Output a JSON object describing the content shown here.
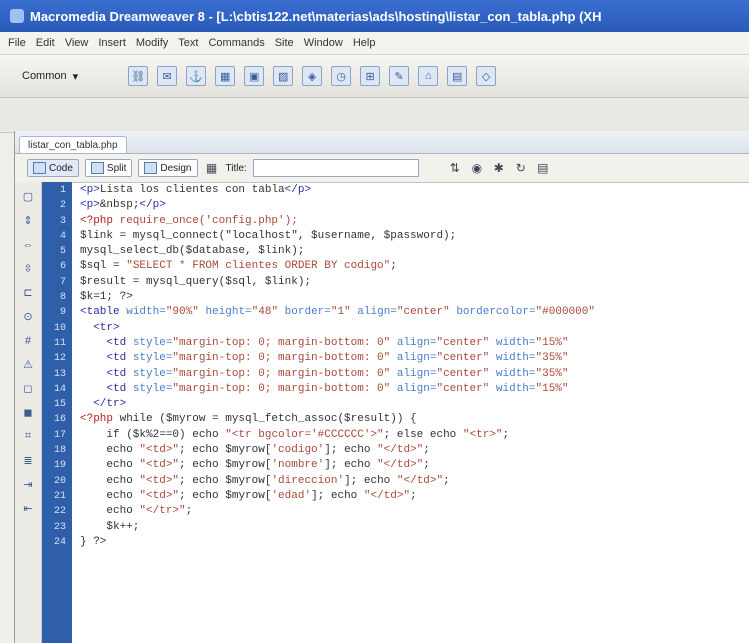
{
  "window": {
    "title": "Macromedia Dreamweaver 8 - [L:\\cbtis122.net\\materias\\ads\\hosting\\listar_con_tabla.php (XH"
  },
  "menu": [
    "File",
    "Edit",
    "View",
    "Insert",
    "Modify",
    "Text",
    "Commands",
    "Site",
    "Window",
    "Help"
  ],
  "insert_bar": {
    "category": "Common",
    "icons": [
      "hyperlink-icon",
      "email-icon",
      "anchor-icon",
      "table-icon",
      "div-icon",
      "images-icon",
      "media-icon",
      "date-icon",
      "server-include-icon",
      "comment-icon",
      "head-icon",
      "templates-icon",
      "tag-chooser-icon"
    ]
  },
  "document": {
    "tab": "listar_con_tabla.php",
    "views": {
      "code": "Code",
      "split": "Split",
      "design": "Design"
    },
    "title_label": "Title:",
    "title_value": ""
  },
  "code_lines": [
    {
      "n": "1",
      "parts": [
        {
          "t": "<p>",
          "c": "tg"
        },
        {
          "t": "Lista los clientes con tabla",
          "c": ""
        },
        {
          "t": "</p>",
          "c": "tg"
        }
      ]
    },
    {
      "n": "2",
      "parts": [
        {
          "t": "<p>",
          "c": "tg"
        },
        {
          "t": "&nbsp;",
          "c": ""
        },
        {
          "t": "</p>",
          "c": "tg"
        }
      ]
    },
    {
      "n": "3",
      "parts": [
        {
          "t": "<?php ",
          "c": "php"
        },
        {
          "t": "require_once('config.php');",
          "c": "str"
        }
      ]
    },
    {
      "n": "4",
      "parts": [
        {
          "t": "$link = mysql_connect(\"localhost\", $username, $password);",
          "c": ""
        }
      ]
    },
    {
      "n": "5",
      "parts": [
        {
          "t": "mysql_select_db($database, $link);",
          "c": ""
        }
      ]
    },
    {
      "n": "6",
      "parts": [
        {
          "t": "$sql = ",
          "c": ""
        },
        {
          "t": "\"SELECT * FROM clientes ORDER BY codigo\"",
          "c": "str"
        },
        {
          "t": ";",
          "c": ""
        }
      ]
    },
    {
      "n": "7",
      "parts": [
        {
          "t": "$result = mysql_query($sql, $link);",
          "c": ""
        }
      ]
    },
    {
      "n": "8",
      "parts": [
        {
          "t": "$k=1; ?>",
          "c": ""
        }
      ]
    },
    {
      "n": "9",
      "parts": [
        {
          "t": "<table ",
          "c": "tg"
        },
        {
          "t": "width=",
          "c": "attr"
        },
        {
          "t": "\"90%\" ",
          "c": "str"
        },
        {
          "t": "height=",
          "c": "attr"
        },
        {
          "t": "\"48\" ",
          "c": "str"
        },
        {
          "t": "border=",
          "c": "attr"
        },
        {
          "t": "\"1\" ",
          "c": "str"
        },
        {
          "t": "align=",
          "c": "attr"
        },
        {
          "t": "\"center\" ",
          "c": "str"
        },
        {
          "t": "bordercolor=",
          "c": "attr"
        },
        {
          "t": "\"#000000\"",
          "c": "str"
        }
      ]
    },
    {
      "n": "10",
      "parts": [
        {
          "t": "  <tr>",
          "c": "tg"
        }
      ]
    },
    {
      "n": "11",
      "parts": [
        {
          "t": "    <td ",
          "c": "tg"
        },
        {
          "t": "style=",
          "c": "attr"
        },
        {
          "t": "\"margin-top: 0; margin-bottom: 0\" ",
          "c": "str"
        },
        {
          "t": "align=",
          "c": "attr"
        },
        {
          "t": "\"center\" ",
          "c": "str"
        },
        {
          "t": "width=",
          "c": "attr"
        },
        {
          "t": "\"15%\" ",
          "c": "str"
        }
      ]
    },
    {
      "n": "12",
      "parts": [
        {
          "t": "    <td ",
          "c": "tg"
        },
        {
          "t": "style=",
          "c": "attr"
        },
        {
          "t": "\"margin-top: 0; margin-bottom: 0\" ",
          "c": "str"
        },
        {
          "t": "align=",
          "c": "attr"
        },
        {
          "t": "\"center\" ",
          "c": "str"
        },
        {
          "t": "width=",
          "c": "attr"
        },
        {
          "t": "\"35%\" ",
          "c": "str"
        }
      ]
    },
    {
      "n": "13",
      "parts": [
        {
          "t": "    <td ",
          "c": "tg"
        },
        {
          "t": "style=",
          "c": "attr"
        },
        {
          "t": "\"margin-top: 0; margin-bottom: 0\" ",
          "c": "str"
        },
        {
          "t": "align=",
          "c": "attr"
        },
        {
          "t": "\"center\" ",
          "c": "str"
        },
        {
          "t": "width=",
          "c": "attr"
        },
        {
          "t": "\"35%\" ",
          "c": "str"
        }
      ]
    },
    {
      "n": "14",
      "parts": [
        {
          "t": "    <td ",
          "c": "tg"
        },
        {
          "t": "style=",
          "c": "attr"
        },
        {
          "t": "\"margin-top: 0; margin-bottom: 0\" ",
          "c": "str"
        },
        {
          "t": "align=",
          "c": "attr"
        },
        {
          "t": "\"center\" ",
          "c": "str"
        },
        {
          "t": "width=",
          "c": "attr"
        },
        {
          "t": "\"15%\" ",
          "c": "str"
        }
      ]
    },
    {
      "n": "15",
      "parts": [
        {
          "t": "  </tr>",
          "c": "tg"
        }
      ]
    },
    {
      "n": "16",
      "parts": [
        {
          "t": "<?php ",
          "c": "php"
        },
        {
          "t": "while ($myrow = mysql_fetch_assoc($result)) {",
          "c": ""
        }
      ]
    },
    {
      "n": "17",
      "parts": [
        {
          "t": "    if ($k%2==0) echo ",
          "c": ""
        },
        {
          "t": "\"<tr bgcolor='#CCCCCC'>\"",
          "c": "str"
        },
        {
          "t": "; else echo ",
          "c": ""
        },
        {
          "t": "\"<tr>\"",
          "c": "str"
        },
        {
          "t": ";",
          "c": ""
        }
      ]
    },
    {
      "n": "18",
      "parts": [
        {
          "t": "    echo ",
          "c": ""
        },
        {
          "t": "\"<td>\"",
          "c": "str"
        },
        {
          "t": "; echo $myrow[",
          "c": ""
        },
        {
          "t": "'codigo'",
          "c": "str"
        },
        {
          "t": "]; echo ",
          "c": ""
        },
        {
          "t": "\"</td>\"",
          "c": "str"
        },
        {
          "t": ";",
          "c": ""
        }
      ]
    },
    {
      "n": "19",
      "parts": [
        {
          "t": "    echo ",
          "c": ""
        },
        {
          "t": "\"<td>\"",
          "c": "str"
        },
        {
          "t": "; echo $myrow[",
          "c": ""
        },
        {
          "t": "'nombre'",
          "c": "str"
        },
        {
          "t": "]; echo ",
          "c": ""
        },
        {
          "t": "\"</td>\"",
          "c": "str"
        },
        {
          "t": ";",
          "c": ""
        }
      ]
    },
    {
      "n": "20",
      "parts": [
        {
          "t": "    echo ",
          "c": ""
        },
        {
          "t": "\"<td>\"",
          "c": "str"
        },
        {
          "t": "; echo $myrow[",
          "c": ""
        },
        {
          "t": "'direccion'",
          "c": "str"
        },
        {
          "t": "]; echo ",
          "c": ""
        },
        {
          "t": "\"</td>\"",
          "c": "str"
        },
        {
          "t": ";",
          "c": ""
        }
      ]
    },
    {
      "n": "21",
      "parts": [
        {
          "t": "    echo ",
          "c": ""
        },
        {
          "t": "\"<td>\"",
          "c": "str"
        },
        {
          "t": "; echo $myrow[",
          "c": ""
        },
        {
          "t": "'edad'",
          "c": "str"
        },
        {
          "t": "]; echo ",
          "c": ""
        },
        {
          "t": "\"</td>\"",
          "c": "str"
        },
        {
          "t": ";",
          "c": ""
        }
      ]
    },
    {
      "n": "22",
      "parts": [
        {
          "t": "    echo ",
          "c": ""
        },
        {
          "t": "\"</tr>\"",
          "c": "str"
        },
        {
          "t": ";",
          "c": ""
        }
      ]
    },
    {
      "n": "23",
      "parts": [
        {
          "t": "    $k++;",
          "c": ""
        }
      ]
    },
    {
      "n": "24",
      "parts": [
        {
          "t": "} ?>",
          "c": ""
        }
      ]
    }
  ]
}
